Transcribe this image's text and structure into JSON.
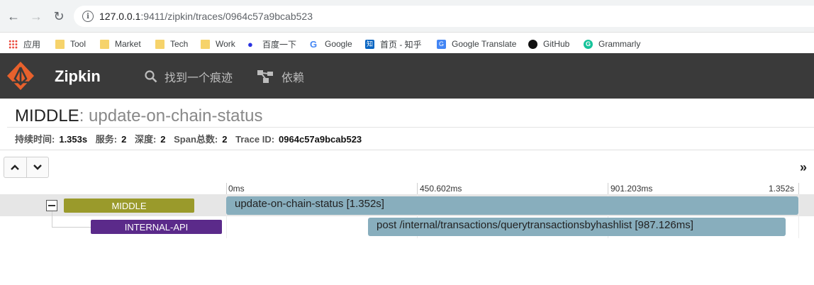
{
  "browser": {
    "url_host": "127.0.0.1",
    "url_rest": ":9411/zipkin/traces/0964c57a9bcab523",
    "bookmarks": [
      {
        "label": "应用",
        "icon": "apps-grid-icon"
      },
      {
        "label": "Tool",
        "icon": "folder-icon"
      },
      {
        "label": "Market",
        "icon": "folder-icon"
      },
      {
        "label": "Tech",
        "icon": "folder-icon"
      },
      {
        "label": "Work",
        "icon": "folder-icon"
      },
      {
        "label": "百度一下",
        "icon": "baidu-paw-icon"
      },
      {
        "label": "Google",
        "icon": "google-g-icon"
      },
      {
        "label": "首页 - 知乎",
        "icon": "zhihu-icon"
      },
      {
        "label": "Google Translate",
        "icon": "google-translate-icon"
      },
      {
        "label": "GitHub",
        "icon": "github-icon"
      },
      {
        "label": "Grammarly",
        "icon": "grammarly-icon"
      }
    ]
  },
  "zipkin": {
    "brand": "Zipkin",
    "nav_find": "找到一个痕迹",
    "nav_deps": "依赖",
    "logo_color": "#e8612c"
  },
  "trace": {
    "service": "MIDDLE",
    "span_name": ": update-on-chain-status",
    "meta": {
      "duration_label": "持续时间:",
      "duration_value": "1.353s",
      "services_label": "服务:",
      "services_value": "2",
      "depth_label": "深度:",
      "depth_value": "2",
      "span_count_label": "Span总数:",
      "span_count_value": "2",
      "trace_id_label": "Trace ID:",
      "trace_id_value": "0964c57a9bcab523"
    }
  },
  "controls": {
    "expand_up": "^",
    "expand_down": "⌄",
    "collapse_right": "»"
  },
  "timeline": {
    "ticks": [
      "0ms",
      "450.602ms",
      "901.203ms",
      "1.352s"
    ]
  },
  "spans": [
    {
      "service": "MIDDLE",
      "label": "update-on-chain-status [1.352s]",
      "service_color": "#9a9a2b"
    },
    {
      "service": "INTERNAL-API",
      "label": "post /internal/transactions/querytransactionsbyhashlist [987.126ms]",
      "service_color": "#5b2a8a"
    }
  ],
  "colors": {
    "span_bar": "#88aebd",
    "header_bg": "#3a3a3a"
  }
}
